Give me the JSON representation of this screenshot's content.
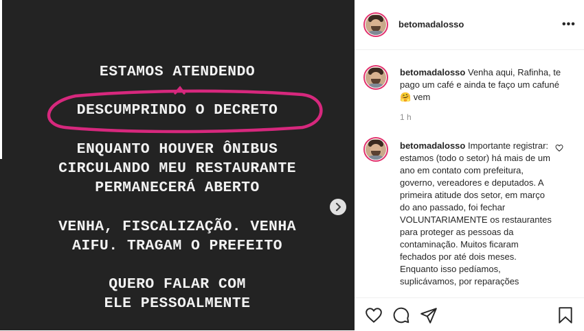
{
  "story": {
    "lines": [
      "ESTAMOS ATENDENDO",
      "DESCUMPRINDO O DECRETO",
      "ENQUANTO HOUVER ÔNIBUS",
      "CIRCULANDO MEU RESTAURANTE",
      "PERMANECERÁ ABERTO",
      "VENHA, FISCALIZAÇÃO. VENHA",
      "AIFU. TRAGAM O PREFEITO",
      "QUERO FALAR COM",
      "ELE PESSOALMENTE"
    ],
    "highlight_color": "#d6287d",
    "background_color": "#232323"
  },
  "header": {
    "username": "betomadalosso",
    "more_label": "•••"
  },
  "comments": [
    {
      "username": "betomadalosso",
      "text": "Venha aqui, Rafinha, te pago um café e ainda te faço um cafuné 🤗 vem",
      "time": "1 h"
    },
    {
      "username": "betomadalosso",
      "text": "Importante registrar: estamos (todo o setor) há mais de um ano em contato com prefeitura, governo, vereadores e deputados. A primeira atitude dos setor, em março do ano passado, foi fechar VOLUNTARIAMENTE os restaurantes para proteger as pessoas da contaminação. Muitos ficaram fechados por até dois meses. Enquanto isso pedíamos, suplicávamos, por reparações"
    }
  ],
  "actions": {
    "like": "heart-icon",
    "comment": "comment-icon",
    "share": "share-icon",
    "save": "bookmark-icon"
  }
}
